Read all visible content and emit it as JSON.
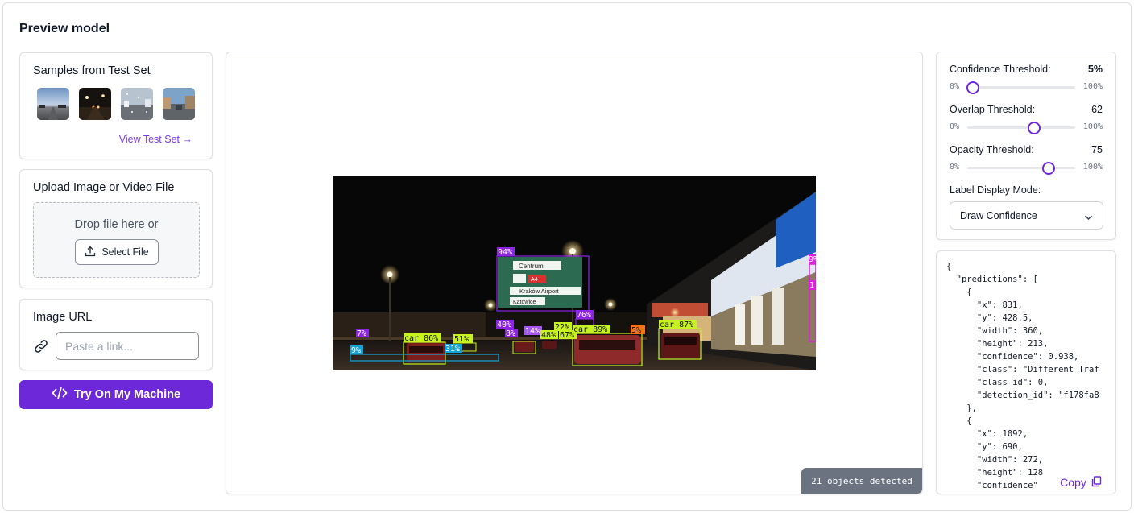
{
  "page": {
    "title": "Preview model"
  },
  "samples": {
    "title": "Samples from Test Set",
    "thumbnails": [
      "sample-road-day",
      "sample-road-night",
      "sample-rainy-windshield",
      "sample-street"
    ],
    "view_link": "View Test Set",
    "view_arrow": "→"
  },
  "upload": {
    "title": "Upload Image or Video File",
    "drop_text": "Drop file here or",
    "select_label": "Select File",
    "upload_icon": "upload-icon"
  },
  "image_url": {
    "title": "Image URL",
    "placeholder": "Paste a link...",
    "link_icon": "link-icon"
  },
  "try_button": {
    "label": "Try On My Machine",
    "icon": "code-icon"
  },
  "preview": {
    "objects_detected": "21 objects detected",
    "detections": [
      {
        "label": "94%",
        "color": "#8e24e8"
      },
      {
        "label": "76%",
        "color": "#8e24e8"
      },
      {
        "label": "40%",
        "color": "#8e24e8"
      },
      {
        "label": "8%",
        "color": "#8e24e8"
      },
      {
        "label": "14%",
        "color": "#a855f7"
      },
      {
        "label": "7%",
        "color": "#8e24e8"
      },
      {
        "label": "car 86%",
        "color": "#c6f21f"
      },
      {
        "label": "51%",
        "color": "#c6f21f"
      },
      {
        "label": "48%",
        "color": "#c6f21f"
      },
      {
        "label": "22%",
        "color": "#c6f21f"
      },
      {
        "label": "67%",
        "color": "#c6f21f"
      },
      {
        "label": "car 89%",
        "color": "#c6f21f"
      },
      {
        "label": "car 87%",
        "color": "#c6f21f"
      },
      {
        "label": "5%",
        "color": "#f97316"
      },
      {
        "label": "9%",
        "color": "#14a5d8"
      },
      {
        "label": "31%",
        "color": "#14a5d8"
      },
      {
        "label": "9%",
        "color": "#e11de0"
      },
      {
        "label": "1",
        "color": "#e11de0"
      }
    ],
    "sign_text": [
      "Centrum",
      "A4",
      "Kraków Airport",
      "Katowice"
    ]
  },
  "controls": {
    "confidence": {
      "label": "Confidence Threshold:",
      "value": "5%",
      "min": "0%",
      "max": "100%",
      "level": 0.05
    },
    "overlap": {
      "label": "Overlap Threshold:",
      "value": "62",
      "min": "0%",
      "max": "100%",
      "level": 0.62
    },
    "opacity": {
      "label": "Opacity Threshold:",
      "value": "75",
      "min": "0%",
      "max": "100%",
      "level": 0.75
    },
    "label_mode": {
      "label": "Label Display Mode:",
      "selected": "Draw Confidence"
    }
  },
  "json_output": {
    "text": "{\n  \"predictions\": [\n    {\n      \"x\": 831,\n      \"y\": 428.5,\n      \"width\": 360,\n      \"height\": 213,\n      \"confidence\": 0.938,\n      \"class\": \"Different Traf\n      \"class_id\": 0,\n      \"detection_id\": \"f178fa8\n    },\n    {\n      \"x\": 1092,\n      \"y\": 690,\n      \"width\": 272,\n      \"height\": 128\n      \"confidence\"",
    "copy_label": "Copy"
  },
  "colors": {
    "accent": "#6d28d9",
    "link": "#7c3aed",
    "badge": "#6b7280"
  }
}
